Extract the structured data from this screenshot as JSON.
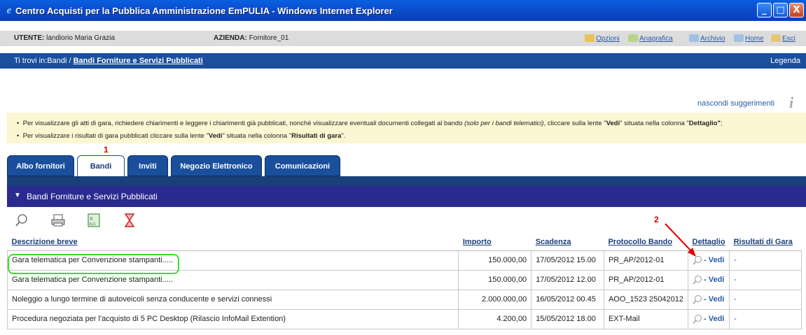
{
  "window": {
    "title": "Centro Acquisti per la Pubblica Amministrazione EmPULIA - Windows Internet Explorer",
    "min": "_",
    "max": "□",
    "close": "X"
  },
  "userbar": {
    "user_label": "UTENTE:",
    "user_value": "landiorio Maria Grazia",
    "company_label": "AZIENDA:",
    "company_value": "Fornitore_01",
    "links": [
      "Opzioni",
      "Anagrafica",
      "Archivio",
      "Home",
      "Esci"
    ]
  },
  "breadcrumb": {
    "prefix": "Ti trovi in:Bandi / ",
    "current": "Bandi Forniture e Servizi Pubblicati",
    "legend": "Legenda"
  },
  "hints": {
    "hide_label": "nascondi suggerimenti",
    "info_glyph": "i",
    "line1_a": "Per visualizzare gli atti di gara, richiedere chiarimenti e leggere i chiarimenti già pubblicati, nonché visualizzare eventuali documenti collegati al bando ",
    "line1_b": "(solo per i bandi telematici)",
    "line1_c": ", cliccare sulla lente \"",
    "line1_d": "Vedi",
    "line1_e": "\" situata nella colonna \"",
    "line1_f": "Dettaglio\"",
    "line1_g": ";",
    "line2_a": "Per visualizzare i risultati di gara pubblicati cliccare sulla lente \"",
    "line2_b": "Vedi",
    "line2_c": "\" situata nella colonna \"",
    "line2_d": "Risultati di gara",
    "line2_e": "\"."
  },
  "annotations": {
    "one": "1",
    "two": "2"
  },
  "tabs": [
    {
      "label": "Albo fornitori",
      "active": false
    },
    {
      "label": "Bandi",
      "active": true
    },
    {
      "label": "Inviti",
      "active": false
    },
    {
      "label": "Negozio Elettronico",
      "active": false
    },
    {
      "label": "Comunicazioni",
      "active": false
    }
  ],
  "section": {
    "arrow": "▼",
    "title": "Bandi Forniture e Servizi Pubblicati"
  },
  "table": {
    "headers": [
      "Descrizione breve",
      "Importo",
      "Scadenza",
      "Protocollo Bando",
      "Dettaglio",
      "Risultati di Gara"
    ],
    "rows": [
      {
        "desc": "Gara telematica per Convenzione stampanti.....",
        "importo": "150.000,00",
        "scadenza": "17/05/2012 15.00",
        "protocollo": "PR_AP/2012-01",
        "vedi": "- Vedi",
        "risultati": "-"
      },
      {
        "desc": "Gara telematica per Convenzione stampanti.....",
        "importo": "150.000,00",
        "scadenza": "17/05/2012 12.00",
        "protocollo": "PR_AP/2012-01",
        "vedi": "- Vedi",
        "risultati": "-"
      },
      {
        "desc": "Noleggio a lungo termine di autoveicoli senza conducente e servizi connessi",
        "importo": "2.000.000,00",
        "scadenza": "16/05/2012 00.45",
        "protocollo": "AOO_1523 25042012",
        "vedi": "- Vedi",
        "risultati": "-"
      },
      {
        "desc": "Procedura negoziata per l'acquisto di 5 PC Desktop (Rilascio InfoMail Extention)",
        "importo": "4.200,00",
        "scadenza": "15/05/2012 18.00",
        "protocollo": "EXT-Mail",
        "vedi": "- Vedi",
        "risultati": "-"
      }
    ]
  },
  "colors": {
    "accent": "#1a4f9c",
    "section": "#2a2a8f",
    "hint_bg": "#fbf7d2",
    "highlight": "#3ddb2e",
    "annotation": "#dd0000"
  }
}
